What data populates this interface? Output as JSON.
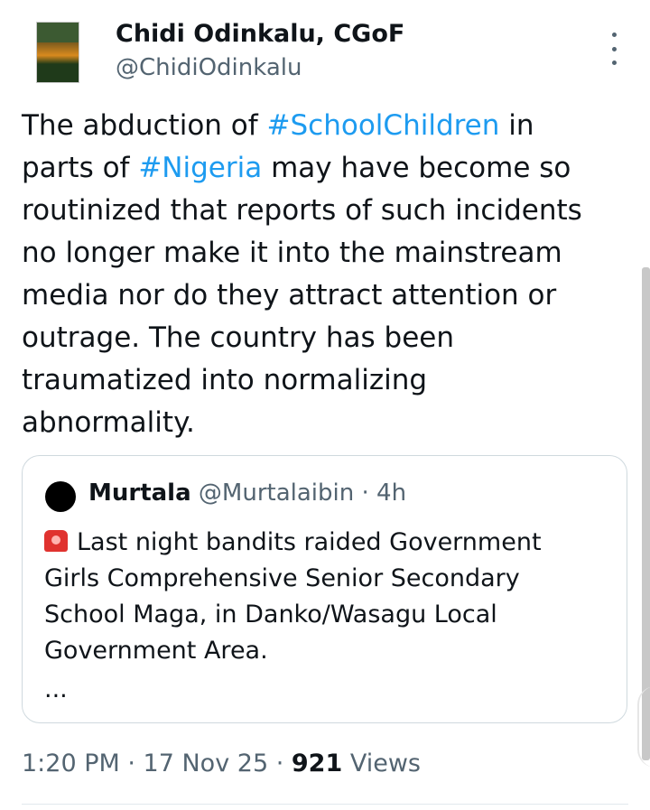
{
  "author": {
    "name": "Chidi Odinkalu, CGoF",
    "handle": "@ChidiOdinkalu",
    "avatar_icon": "book-cover-avatar"
  },
  "tweet": {
    "segments": [
      {
        "text": "The abduction of ",
        "type": "text"
      },
      {
        "text": "#SchoolChildren",
        "type": "hashtag"
      },
      {
        "text": " in parts of ",
        "type": "text"
      },
      {
        "text": "#Nigeria",
        "type": "hashtag"
      },
      {
        "text": " may have become so routinized that reports of such incidents no longer make it into the mainstream media nor do they attract attention or outrage. The country has been traumatized into normalizing abnormality.",
        "type": "text"
      }
    ]
  },
  "quote": {
    "name": "Murtala",
    "handle": "@Murtalaibin",
    "separator": " · ",
    "time": "4h",
    "icon": "police-siren-icon",
    "text": "Last night bandits raided Government Girls Comprehensive Senior Secondary School Maga, in Danko/Wasagu Local Government Area.",
    "ellipsis": "..."
  },
  "meta": {
    "time": "1:20 PM",
    "sep1": " · ",
    "date": "17 Nov 25",
    "sep2": " · ",
    "views_count": "921",
    "views_label": " Views"
  },
  "colors": {
    "hashtag": "#1d9bf0",
    "secondary_text": "#536471",
    "primary_text": "#0f1419",
    "border": "#cfd9de"
  }
}
